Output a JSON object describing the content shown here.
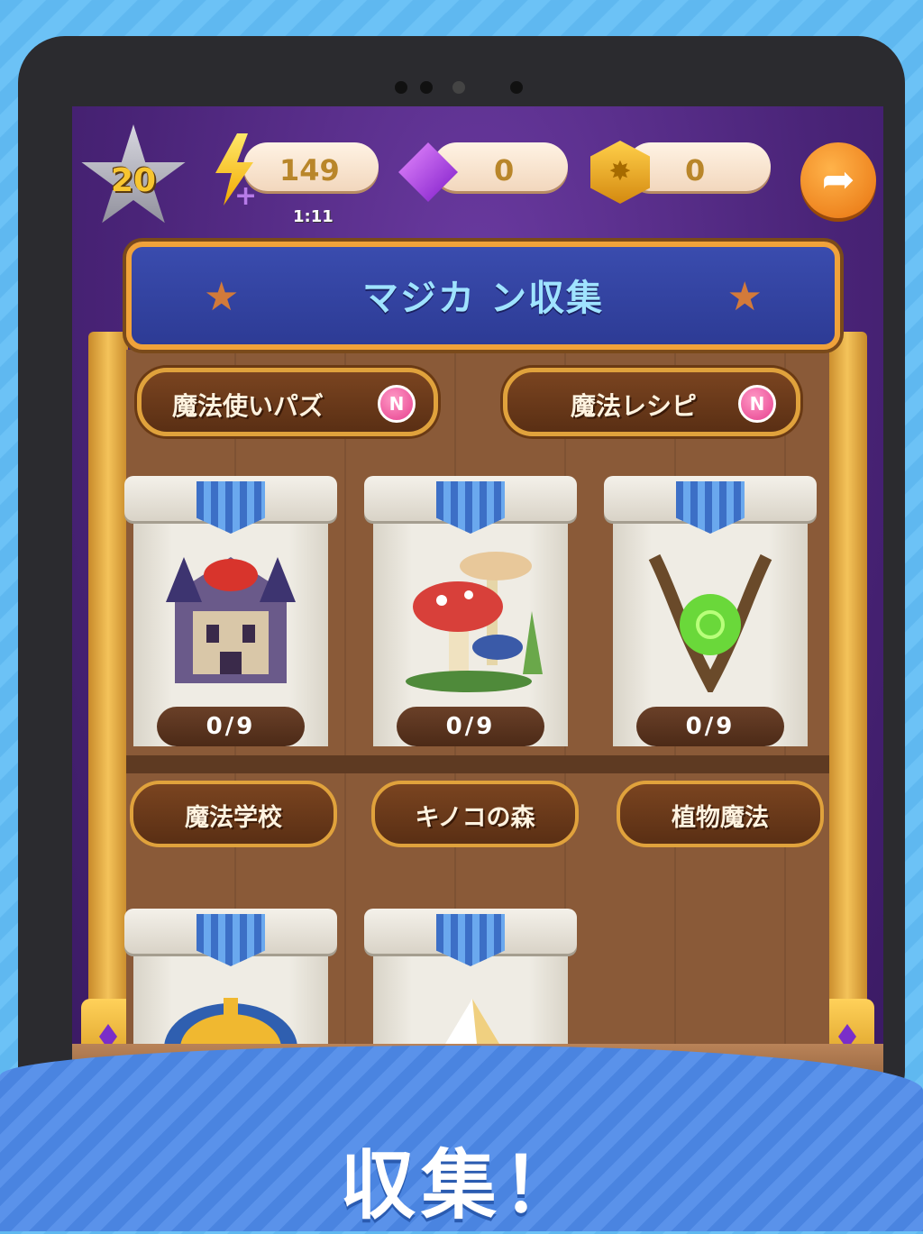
{
  "hud": {
    "level": "20",
    "energy": "149",
    "energy_timer": "1:11",
    "gems": "0",
    "coins": "0",
    "energy_icon": "lightning-bolt-icon",
    "gem_icon": "purple-gem-icon",
    "coin_icon": "dragon-coin-icon",
    "share_icon": "share-arrow-icon"
  },
  "banner": {
    "title": "マジカ ン収集"
  },
  "tabs": [
    {
      "label": "魔法使いパズ",
      "badge": "N"
    },
    {
      "label": "魔法レシピ",
      "badge": "N"
    }
  ],
  "collections": [
    {
      "name": "魔法学校",
      "progress": "0/9"
    },
    {
      "name": "キノコの森",
      "progress": "0/9"
    },
    {
      "name": "植物魔法",
      "progress": "0/9"
    },
    {
      "name": "",
      "progress": ""
    },
    {
      "name": "",
      "progress": ""
    }
  ],
  "caption": "収集！",
  "colors": {
    "accent": "#f0a23a",
    "banner": "#2d3b95",
    "wood": "#8a5a38",
    "caption_band": "#4a84e0"
  }
}
